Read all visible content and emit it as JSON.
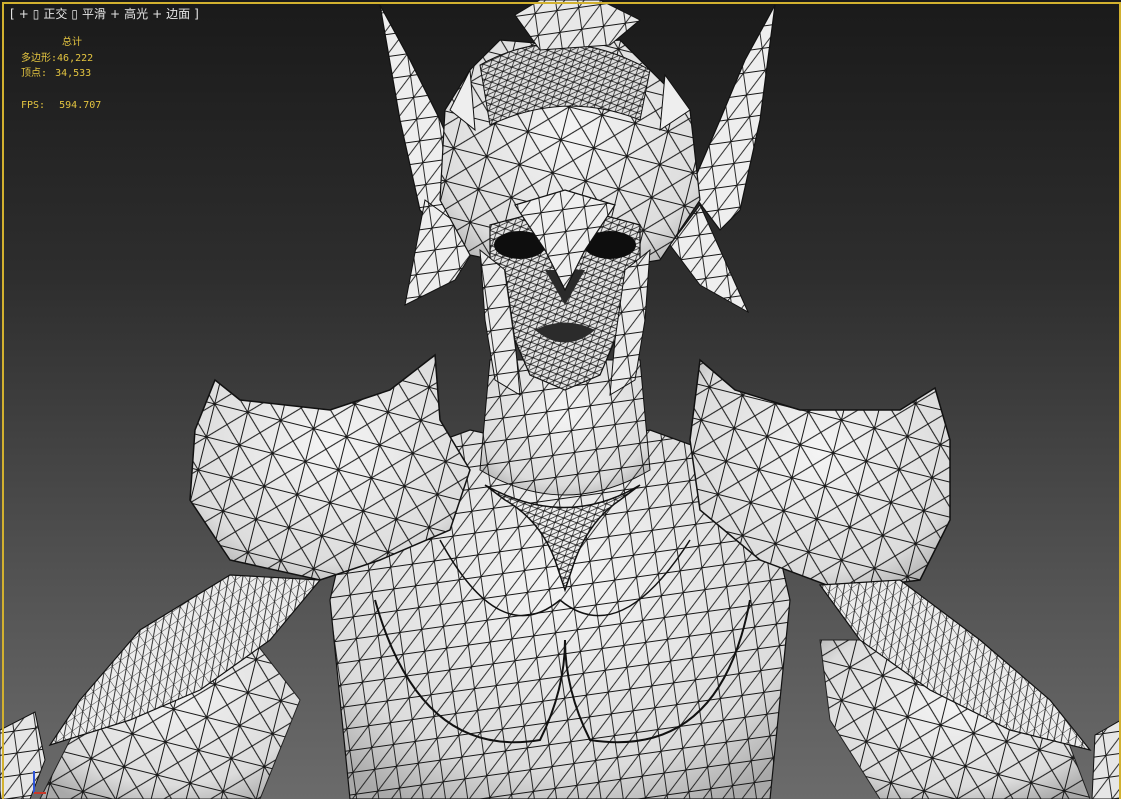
{
  "viewport": {
    "label_segments": [
      "[",
      "+",
      "▯",
      "正交",
      "▯",
      "平滑",
      "+",
      "高光",
      "+",
      "边面",
      "]"
    ],
    "stats": {
      "title": "总计",
      "polygons_label": "多边形:",
      "polygons_value": "46,222",
      "vertices_label": "顶点:",
      "vertices_value": "34,533",
      "fps_label": "FPS:",
      "fps_value": "594.707"
    },
    "colors": {
      "frame_border": "#d2b12f",
      "stats_text": "#e3c440",
      "label_text": "#e6e6e6",
      "mesh_fill": "#ededed",
      "wire": "#111111"
    },
    "icons": [
      "axis-gizmo-icon"
    ],
    "scene": "wireframe armored female character with winged helmet and shoulder pads"
  }
}
